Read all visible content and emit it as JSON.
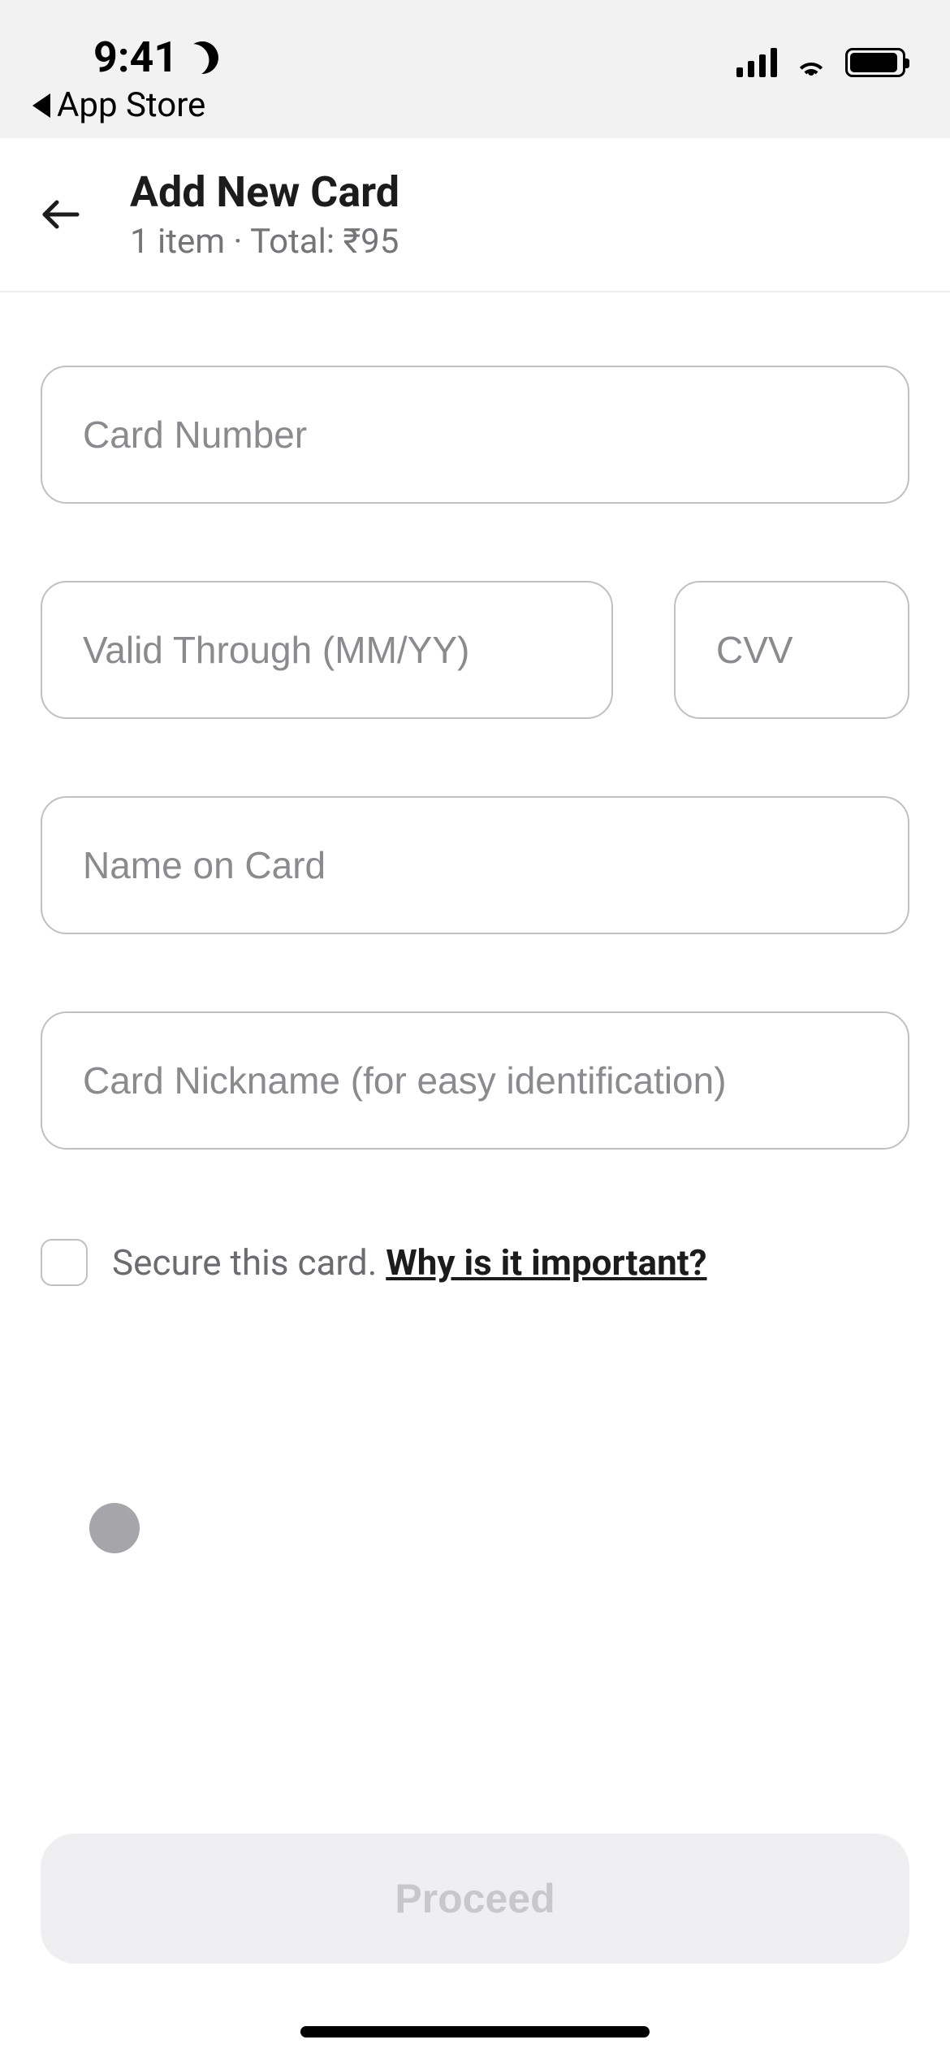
{
  "statusbar": {
    "time": "9:41",
    "back_app": "App Store"
  },
  "header": {
    "title": "Add New Card",
    "subtitle": "1 item · Total: ₹95"
  },
  "form": {
    "card_number_placeholder": "Card Number",
    "valid_through_placeholder": "Valid Through (MM/YY)",
    "cvv_placeholder": "CVV",
    "name_placeholder": "Name on Card",
    "nickname_placeholder": "Card Nickname (for easy identification)",
    "secure_label": "Secure this card. ",
    "secure_link": "Why is it important?"
  },
  "footer": {
    "proceed_label": "Proceed"
  }
}
